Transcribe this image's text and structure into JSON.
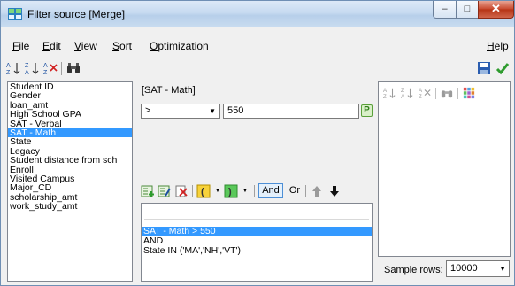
{
  "window": {
    "title": "Filter source  [Merge]",
    "controls": {
      "minimize": "–",
      "maximize": "□",
      "close": "✕"
    }
  },
  "menubar": {
    "file": {
      "ul": "F",
      "rest": "ile"
    },
    "edit": {
      "ul": "E",
      "rest": "dit"
    },
    "view": {
      "ul": "V",
      "rest": "iew"
    },
    "sort": {
      "ul": "S",
      "rest": "ort"
    },
    "optimization": {
      "ul": "O",
      "rest": "ptimization"
    },
    "help": {
      "ul": "H",
      "rest": "elp"
    }
  },
  "toolbar": {
    "sort_asc_icon": "sort-ascending",
    "sort_desc_icon": "sort-descending",
    "clear_sort_icon": "clear-sort",
    "find_icon": "binoculars",
    "save_icon": "floppy-disk",
    "ok_icon": "checkmark",
    "colors": {
      "save": "#2a5db0",
      "ok": "#2e9b2e"
    }
  },
  "fields": [
    "Student ID",
    "Gender",
    "loan_amt",
    "High School GPA",
    "SAT - Verbal",
    "SAT - Math",
    "State",
    "Legacy",
    "Student distance from sch",
    "Enroll",
    "Visited Campus",
    "Major_CD",
    "scholarship_amt",
    "work_study_amt"
  ],
  "selected_field_index": 5,
  "expression": {
    "field_label": "[SAT - Math]",
    "operator": ">",
    "value": "550",
    "p_button": "P"
  },
  "condition_toolbar": {
    "and_label": "And",
    "or_label": "Or",
    "up_icon": "arrow-up",
    "down_icon": "arrow-down"
  },
  "conditions": [
    "SAT - Math > 550",
    "AND",
    "State IN ('MA','NH','VT')"
  ],
  "selected_condition_index": 0,
  "sample": {
    "label": "Sample rows:",
    "value": "10000"
  },
  "colors": {
    "selection": "#3399ff"
  }
}
